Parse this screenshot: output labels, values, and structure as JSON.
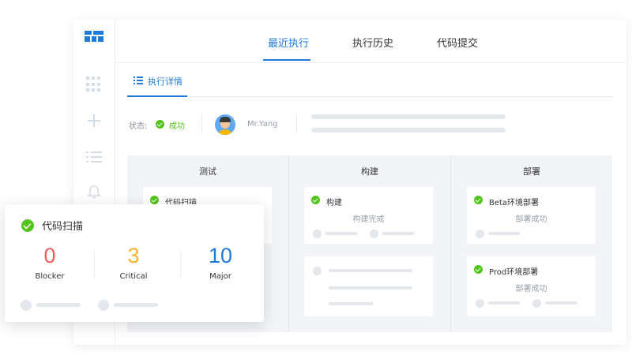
{
  "nav": {
    "tabs": [
      {
        "label": "最近执行",
        "active": true
      },
      {
        "label": "执行历史",
        "active": false
      },
      {
        "label": "代码提交",
        "active": false
      }
    ]
  },
  "detail": {
    "tab_label": "执行详情",
    "status_label": "状态:",
    "status_value": "成功",
    "user_name": "Mr.Yang"
  },
  "stages": [
    {
      "title": "测试",
      "cards": [
        {
          "title": "代码扫描",
          "status": ""
        }
      ]
    },
    {
      "title": "构建",
      "cards": [
        {
          "title": "构建",
          "status": "构建完成"
        }
      ]
    },
    {
      "title": "部署",
      "cards": [
        {
          "title": "Beta环境部署",
          "status": "部署成功"
        },
        {
          "title": "Prod环境部署",
          "status": "部署成功"
        }
      ]
    }
  ],
  "scan_card": {
    "title": "代码扫描",
    "metrics": [
      {
        "value": "0",
        "label": "Blocker",
        "color": "#f05b5b"
      },
      {
        "value": "3",
        "label": "Critical",
        "color": "#f7b32b"
      },
      {
        "value": "10",
        "label": "Major",
        "color": "#1f7bd8"
      }
    ]
  },
  "colors": {
    "accent": "#1f7bd8",
    "success": "#52c41a"
  }
}
